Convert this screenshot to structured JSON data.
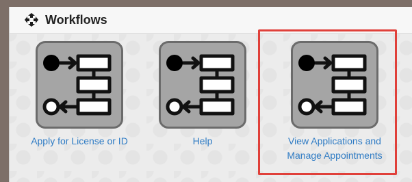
{
  "header": {
    "title": "Workflows",
    "icon": "recycle-arrows-icon"
  },
  "tiles": [
    {
      "label": "Apply for License or ID",
      "icon": "workflow-diagram-icon"
    },
    {
      "label": "Help",
      "icon": "workflow-diagram-icon"
    },
    {
      "label_line1": "View Applications and",
      "label_line2": "Manage Appointments",
      "icon": "workflow-diagram-icon",
      "selected": true
    }
  ],
  "colors": {
    "link": "#2e7bc4",
    "selection": "#e0403a",
    "tile_bg": "#a5a5a5",
    "page_bg": "#7d6f68"
  }
}
